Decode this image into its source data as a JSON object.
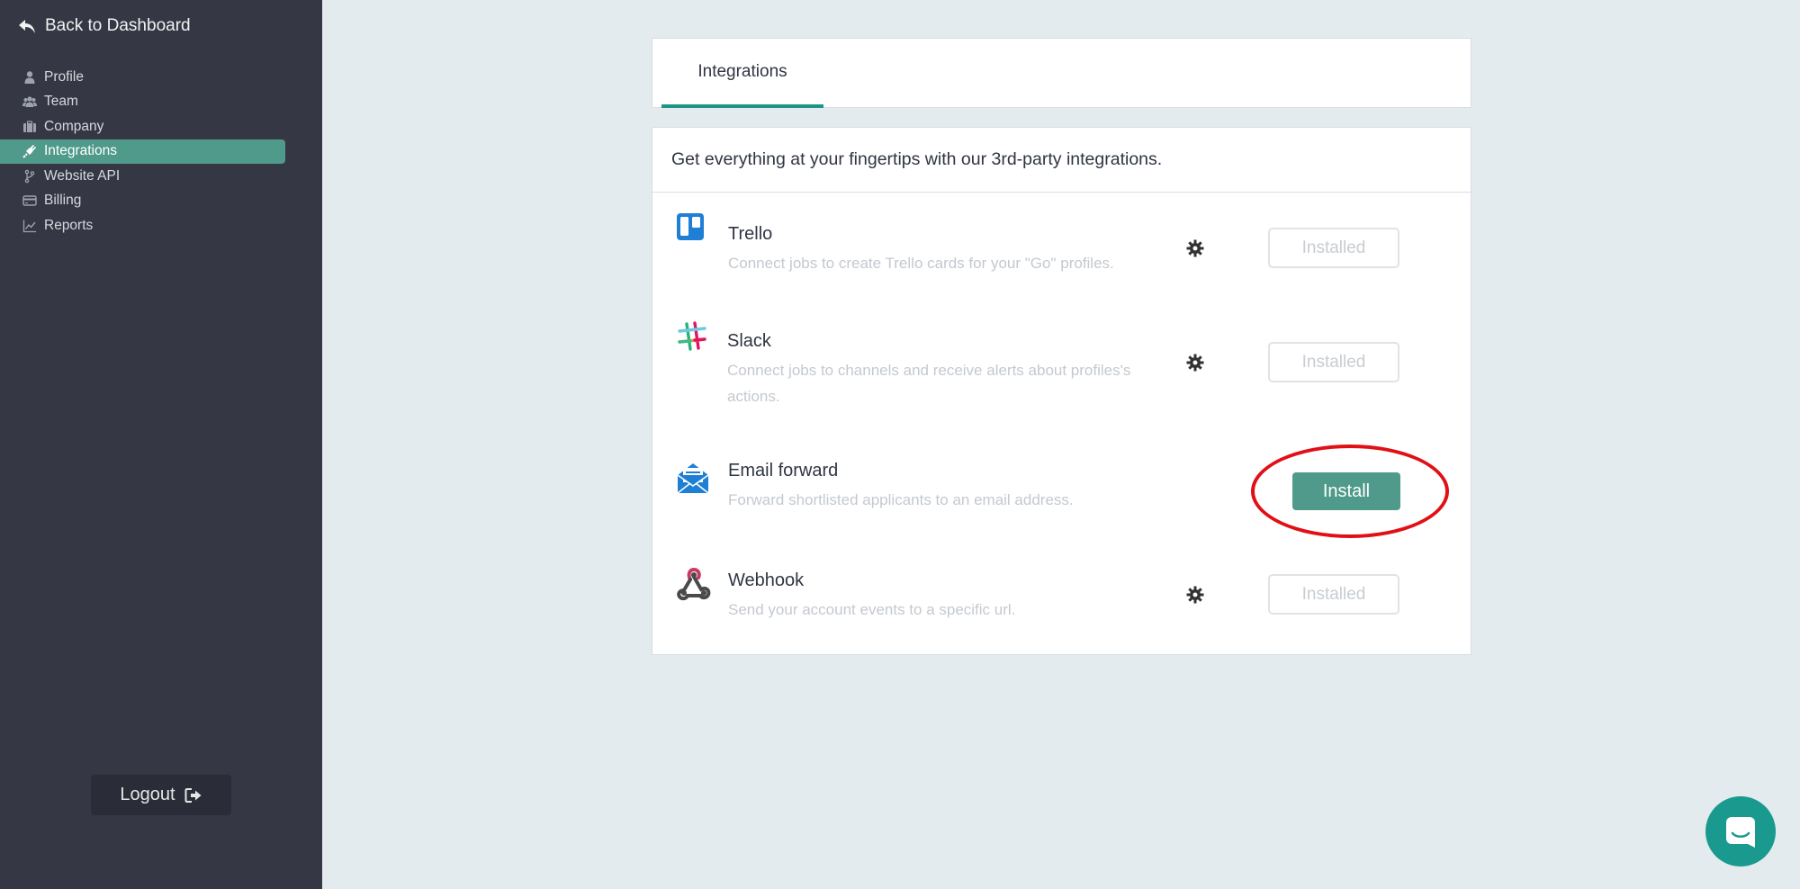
{
  "sidebar": {
    "back_label": "Back to Dashboard",
    "items": [
      {
        "label": "Profile",
        "icon": "user-icon"
      },
      {
        "label": "Team",
        "icon": "users-icon"
      },
      {
        "label": "Company",
        "icon": "briefcase-icon"
      },
      {
        "label": "Integrations",
        "icon": "plug-icon",
        "active": true
      },
      {
        "label": "Website API",
        "icon": "code-branch-icon"
      },
      {
        "label": "Billing",
        "icon": "credit-card-icon"
      },
      {
        "label": "Reports",
        "icon": "line-chart-icon"
      }
    ],
    "logout_label": "Logout"
  },
  "tabs": [
    {
      "label": "Integrations",
      "active": true
    }
  ],
  "intro": "Get everything at your fingertips with our 3rd-party integrations.",
  "integrations": [
    {
      "name": "Trello",
      "description": "Connect jobs to create Trello cards for your \"Go\" profiles.",
      "button": "Installed",
      "installed": true,
      "icon": "trello-icon"
    },
    {
      "name": "Slack",
      "description": "Connect jobs to channels and receive alerts about profiles's actions.",
      "button": "Installed",
      "installed": true,
      "icon": "slack-icon"
    },
    {
      "name": "Email forward",
      "description": "Forward shortlisted applicants to an email address.",
      "button": "Install",
      "installed": false,
      "icon": "email-icon"
    },
    {
      "name": "Webhook",
      "description": "Send your account events to a specific url.",
      "button": "Installed",
      "installed": true,
      "icon": "webhook-icon"
    }
  ],
  "colors": {
    "sidebar_bg": "#353745",
    "accent": "#4f9a8a",
    "tab_underline": "#1e9487",
    "highlight": "#e01016",
    "chat": "#1a9a8e"
  }
}
